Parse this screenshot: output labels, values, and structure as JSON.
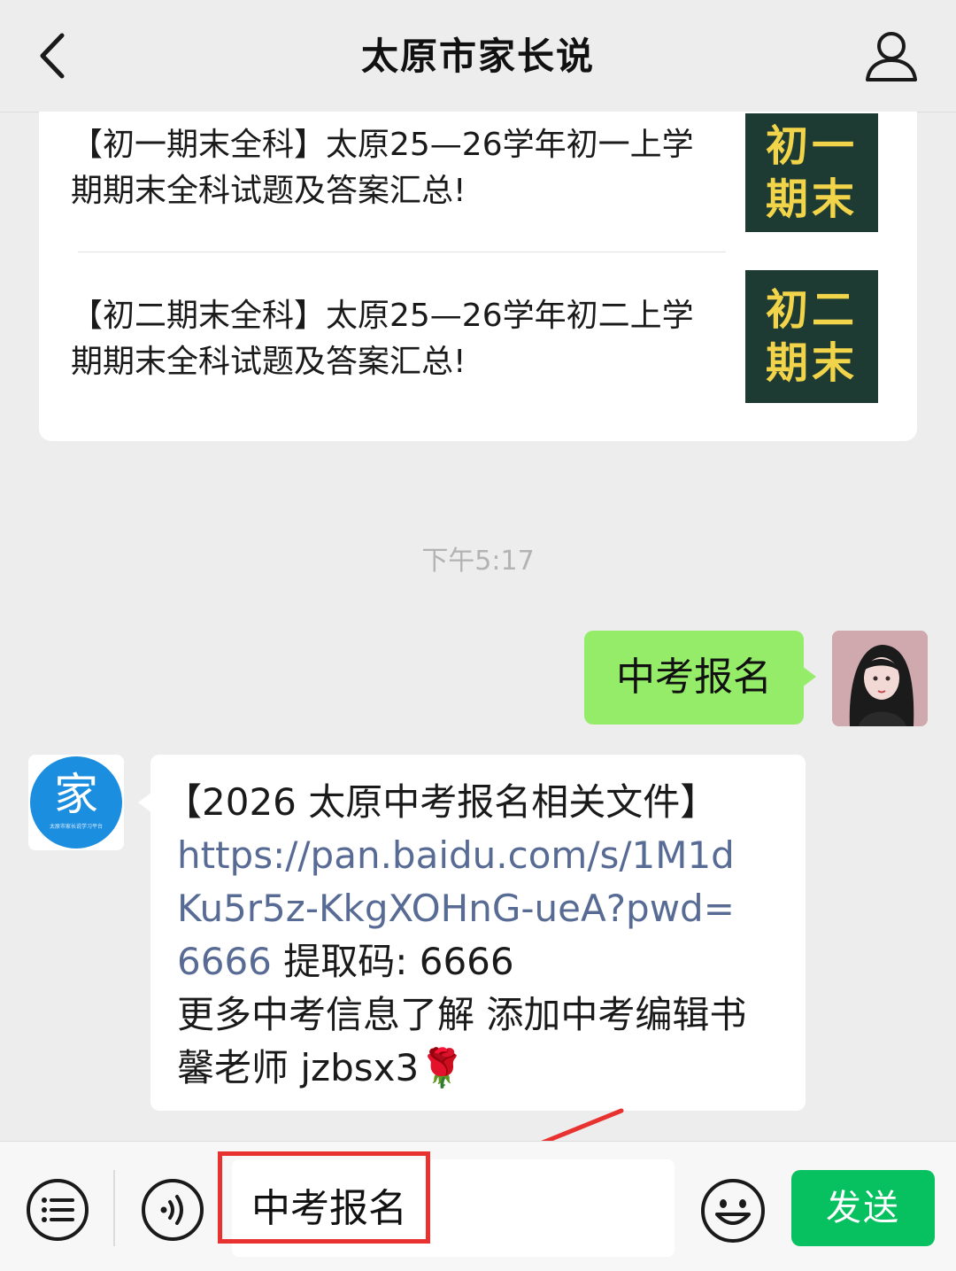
{
  "header": {
    "title": "太原市家长说"
  },
  "articles": [
    {
      "title": "【初一期末全科】太原25—26学年初一上学期期末全科试题及答案汇总!",
      "thumb_line1": "初一",
      "thumb_line2": "期末"
    },
    {
      "title": "【初二期末全科】太原25—26学年初二上学期期末全科试题及答案汇总!",
      "thumb_line1": "初二",
      "thumb_line2": "期末"
    }
  ],
  "chat": {
    "timestamp": "下午5:17",
    "outgoing_message": "中考报名",
    "bot_avatar_glyph": "家",
    "bot_avatar_caption": "太原市家长说学习平台",
    "incoming": {
      "heading": "【2026 太原中考报名相关文件】",
      "link": "https://pan.baidu.com/s/1M1dKu5r5z-KkgXOHnG-ueA?pwd=6666",
      "code_text": " 提取码: 6666",
      "more_text": "更多中考信息了解 添加中考编辑书馨老师 jzbsx3",
      "flower": "🌹"
    }
  },
  "input_bar": {
    "input_value": "中考报名",
    "send_label": "发送"
  },
  "colors": {
    "outgoing_bubble": "#95ec69",
    "send_button": "#07c160",
    "link": "#576b95",
    "highlight": "#e8322f",
    "thumbnail_bg": "#1e3b33",
    "thumbnail_text": "#f2d44a"
  },
  "icons": [
    "back-icon",
    "profile-icon",
    "menu-icon",
    "voice-icon",
    "emoji-icon"
  ]
}
